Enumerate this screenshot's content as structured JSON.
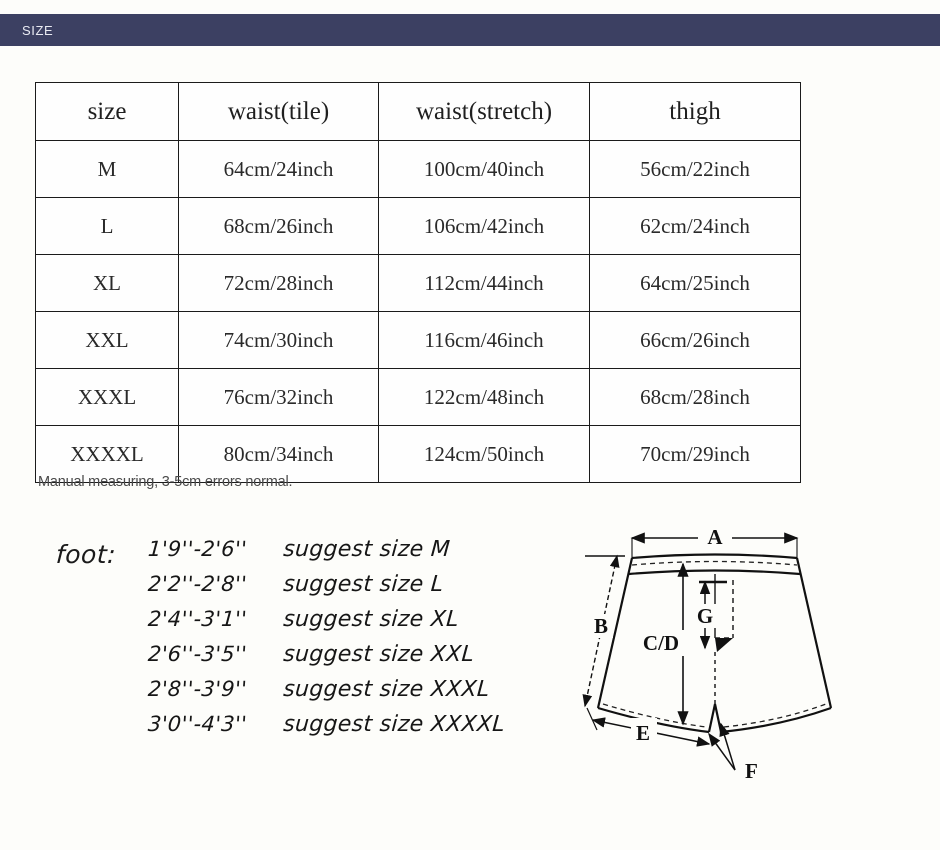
{
  "header": {
    "title": "SIZE",
    "bar_color": "#3c4062",
    "text_color": "#e9eaf2"
  },
  "page": {
    "background": "#fdfdfa"
  },
  "table": {
    "columns": [
      "size",
      "waist(tile)",
      "waist(stretch)",
      "thigh"
    ],
    "rows": [
      {
        "size": "M",
        "waist_tile": "64cm/24inch",
        "waist_stretch": "100cm/40inch",
        "thigh": "56cm/22inch"
      },
      {
        "size": "L",
        "waist_tile": "68cm/26inch",
        "waist_stretch": "106cm/42inch",
        "thigh": "62cm/24inch"
      },
      {
        "size": "XL",
        "waist_tile": "72cm/28inch",
        "waist_stretch": "112cm/44inch",
        "thigh": "64cm/25inch"
      },
      {
        "size": "XXL",
        "waist_tile": "74cm/30inch",
        "waist_stretch": "116cm/46inch",
        "thigh": "66cm/26inch"
      },
      {
        "size": "XXXL",
        "waist_tile": "76cm/32inch",
        "waist_stretch": "122cm/48inch",
        "thigh": "68cm/28inch"
      },
      {
        "size": "XXXXL",
        "waist_tile": "80cm/34inch",
        "waist_stretch": "124cm/50inch",
        "thigh": "70cm/29inch"
      }
    ]
  },
  "note": "Manual measuring, 3-5cm errors normal.",
  "foot": {
    "label": "foot:",
    "lines": [
      {
        "range": "1'9''-2'6''",
        "suggest": "suggest size M"
      },
      {
        "range": "2'2''-2'8''",
        "suggest": "suggest size L"
      },
      {
        "range": "2'4''-3'1''",
        "suggest": "suggest size XL"
      },
      {
        "range": "2'6''-3'5''",
        "suggest": "suggest size XXL"
      },
      {
        "range": "2'8''-3'9''",
        "suggest": "suggest size XXXL"
      },
      {
        "range": "3'0''-4'3''",
        "suggest": "suggest size XXXXL"
      }
    ]
  },
  "diagram": {
    "name": "shorts-measurement-diagram",
    "labels": {
      "a": "A",
      "b": "B",
      "cd": "C/D",
      "e": "E",
      "f": "F",
      "g": "G"
    }
  }
}
